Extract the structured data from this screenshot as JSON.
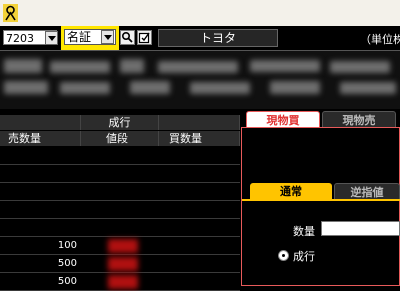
{
  "toolbar": {
    "stock_code": "7203",
    "exchange": "名証",
    "stock_name": "トヨタ",
    "unit_label": "（単位株"
  },
  "book": {
    "header_center": "成行",
    "columns": [
      "売数量",
      "値段",
      "買数量"
    ],
    "rows": [
      {
        "sell_qty": "",
        "price": "",
        "buy_qty": ""
      },
      {
        "sell_qty": "",
        "price": "",
        "buy_qty": ""
      },
      {
        "sell_qty": "",
        "price": "",
        "buy_qty": ""
      },
      {
        "sell_qty": "",
        "price": "",
        "buy_qty": ""
      },
      {
        "sell_qty": "",
        "price": "",
        "buy_qty": ""
      },
      {
        "sell_qty": "100",
        "price": "",
        "buy_qty": ""
      },
      {
        "sell_qty": "500",
        "price": "",
        "buy_qty": ""
      },
      {
        "sell_qty": "500",
        "price": "",
        "buy_qty": ""
      }
    ]
  },
  "order_panel": {
    "tabs": [
      "現物買",
      "現物売"
    ],
    "active_tab": "現物買",
    "subtabs": [
      "通常",
      "逆指値"
    ],
    "active_subtab": "通常",
    "quantity_label": "数量",
    "quantity_value": "",
    "radio_label": "成行"
  },
  "colors": {
    "accent_yellow": "#ffe600",
    "active_tab_red": "#e85a5a",
    "subtab_orange": "#ffc400",
    "background": "#000000"
  }
}
